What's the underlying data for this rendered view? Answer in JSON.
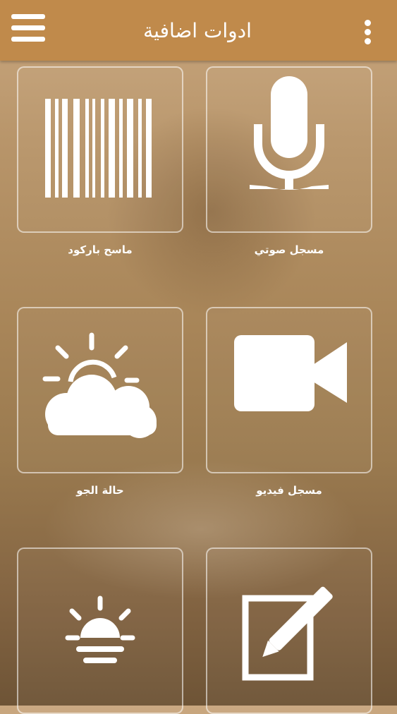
{
  "header": {
    "title": "ادوات اضافية"
  },
  "tools": [
    {
      "label": "مسجل صوتي",
      "icon": "microphone-icon"
    },
    {
      "label": "ماسح باركود",
      "icon": "barcode-icon"
    },
    {
      "label": "مسجل فيديو",
      "icon": "video-camera-icon"
    },
    {
      "label": "حالة الجو",
      "icon": "weather-cloud-sun-icon"
    },
    {
      "label": "",
      "icon": "notepad-pencil-icon"
    },
    {
      "label": "",
      "icon": "sunrise-icon"
    }
  ],
  "colors": {
    "appbar": "#c08a4b",
    "icon": "#ffffff"
  }
}
